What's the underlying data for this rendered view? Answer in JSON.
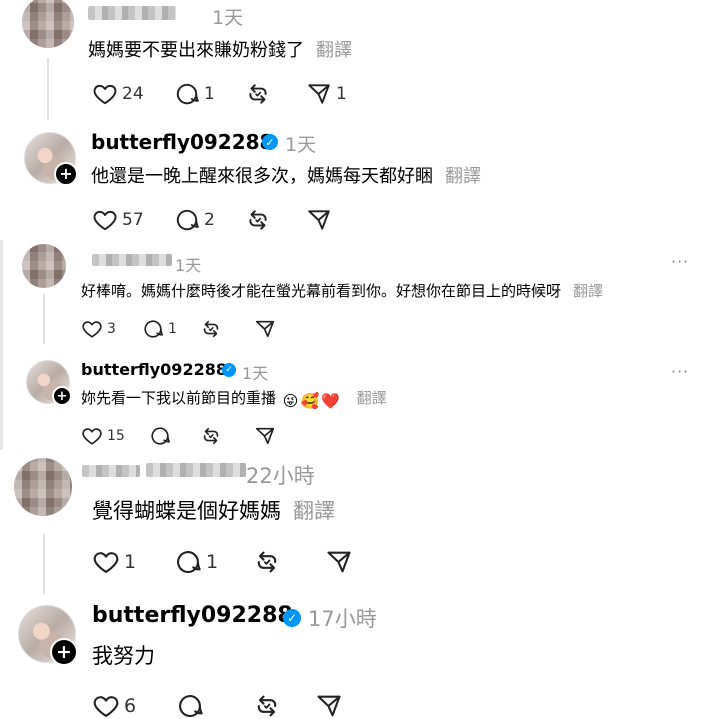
{
  "comments": [
    {
      "id": "c1",
      "username_blurred": true,
      "time": "1天",
      "text": "媽媽要不要出來賺奶粉錢了",
      "translate": "翻譯",
      "likes": "24",
      "replies": "1",
      "reposts": "",
      "shares": "1"
    },
    {
      "id": "c2",
      "username": "butterfly092288",
      "verified": true,
      "time": "1天",
      "text": "他還是一晚上醒來很多次，媽媽每天都好睏",
      "translate": "翻譯",
      "likes": "57",
      "replies": "2",
      "reposts": "",
      "shares": ""
    },
    {
      "id": "c3",
      "username_blurred": true,
      "time": "1天",
      "text": "好棒唷。媽媽什麼時後才能在螢光幕前看到你。好想你在節目上的時候呀",
      "translate": "翻譯",
      "likes": "3",
      "replies": "1",
      "reposts": "",
      "shares": ""
    },
    {
      "id": "c4",
      "username": "butterfly092288",
      "verified": true,
      "time": "1天",
      "text": "妳先看一下我以前節目的重播",
      "emojis": [
        "😜",
        "🥰",
        "❤️"
      ],
      "translate": "翻譯",
      "likes": "15",
      "replies": "",
      "reposts": "",
      "shares": ""
    },
    {
      "id": "c5",
      "username_blurred": true,
      "time": "22小時",
      "text": "覺得蝴蝶是個好媽媽",
      "translate": "翻譯",
      "likes": "1",
      "replies": "1",
      "reposts": "",
      "shares": ""
    },
    {
      "id": "c6",
      "username": "butterfly092288",
      "verified": true,
      "time": "17小時",
      "text": "我努力",
      "translate": "",
      "likes": "6",
      "replies": "",
      "reposts": "",
      "shares": ""
    }
  ],
  "icons": {
    "like": "heart-icon",
    "reply": "comment-icon",
    "repost": "repost-icon",
    "share": "send-icon",
    "more": "more-icon",
    "verified": "verified-badge-icon",
    "follow": "plus-icon"
  },
  "colors": {
    "verified": "#0095f6",
    "muted_text": "#999999",
    "thread_line": "#e0e0e0"
  }
}
